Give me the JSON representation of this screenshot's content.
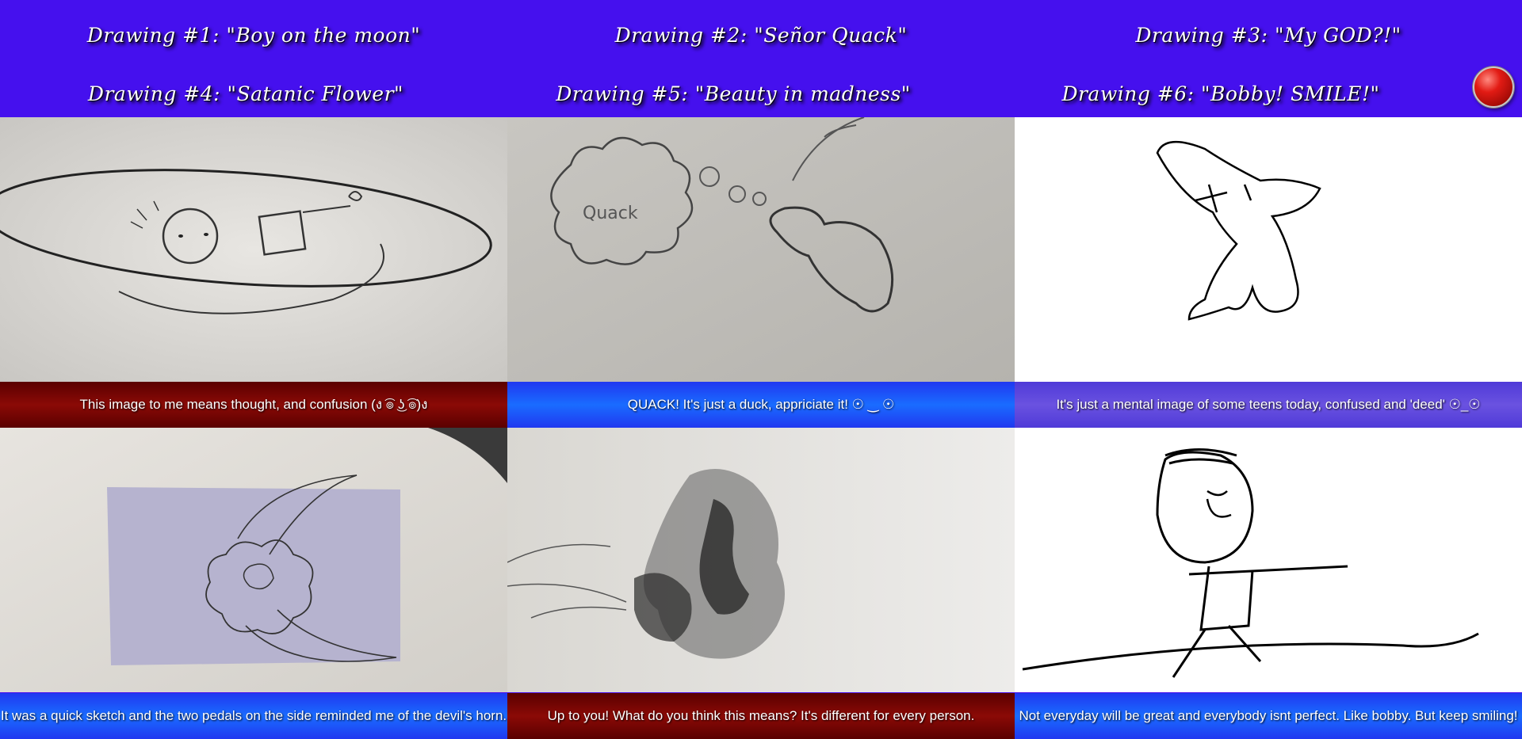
{
  "titles": [
    "Drawing #1: \"Boy on the moon\"",
    "Drawing #2: \"Señor Quack\"",
    "Drawing #3: \"My GOD?!\"",
    "Drawing #4: \"Satanic Flower\"",
    "Drawing #5: \"Beauty in madness\"",
    "Drawing #6: \"Bobby! SMILE!\""
  ],
  "captions": [
    "This image to me means thought, and confusion (ง ͡๏ ͜ʖ ͡๏)ง",
    "QUACK! It's just a duck, appriciate it! ☉ ‿ ☉",
    "It's just a mental image of some teens today, confused and 'deed' ☉_☉",
    "It was a quick sketch and the two pedals on the side reminded me of the devil's horn.",
    "Up to you! What do you think this means? It's different for every person.",
    "Not everyday will be great and everybody isnt perfect. Like bobby. But keep smiling!"
  ],
  "images": [
    "drawing-boy-on-the-moon",
    "drawing-senor-quack",
    "drawing-my-god",
    "drawing-satanic-flower",
    "drawing-beauty-in-madness",
    "drawing-bobby-smile"
  ],
  "colors": {
    "header_bg": "#4510ee",
    "caption_red": "#8b0a06",
    "caption_blue": "#1a6cff",
    "caption_purple": "#6a52e0",
    "record_button": "#e21b14"
  },
  "record_button": "record-icon"
}
